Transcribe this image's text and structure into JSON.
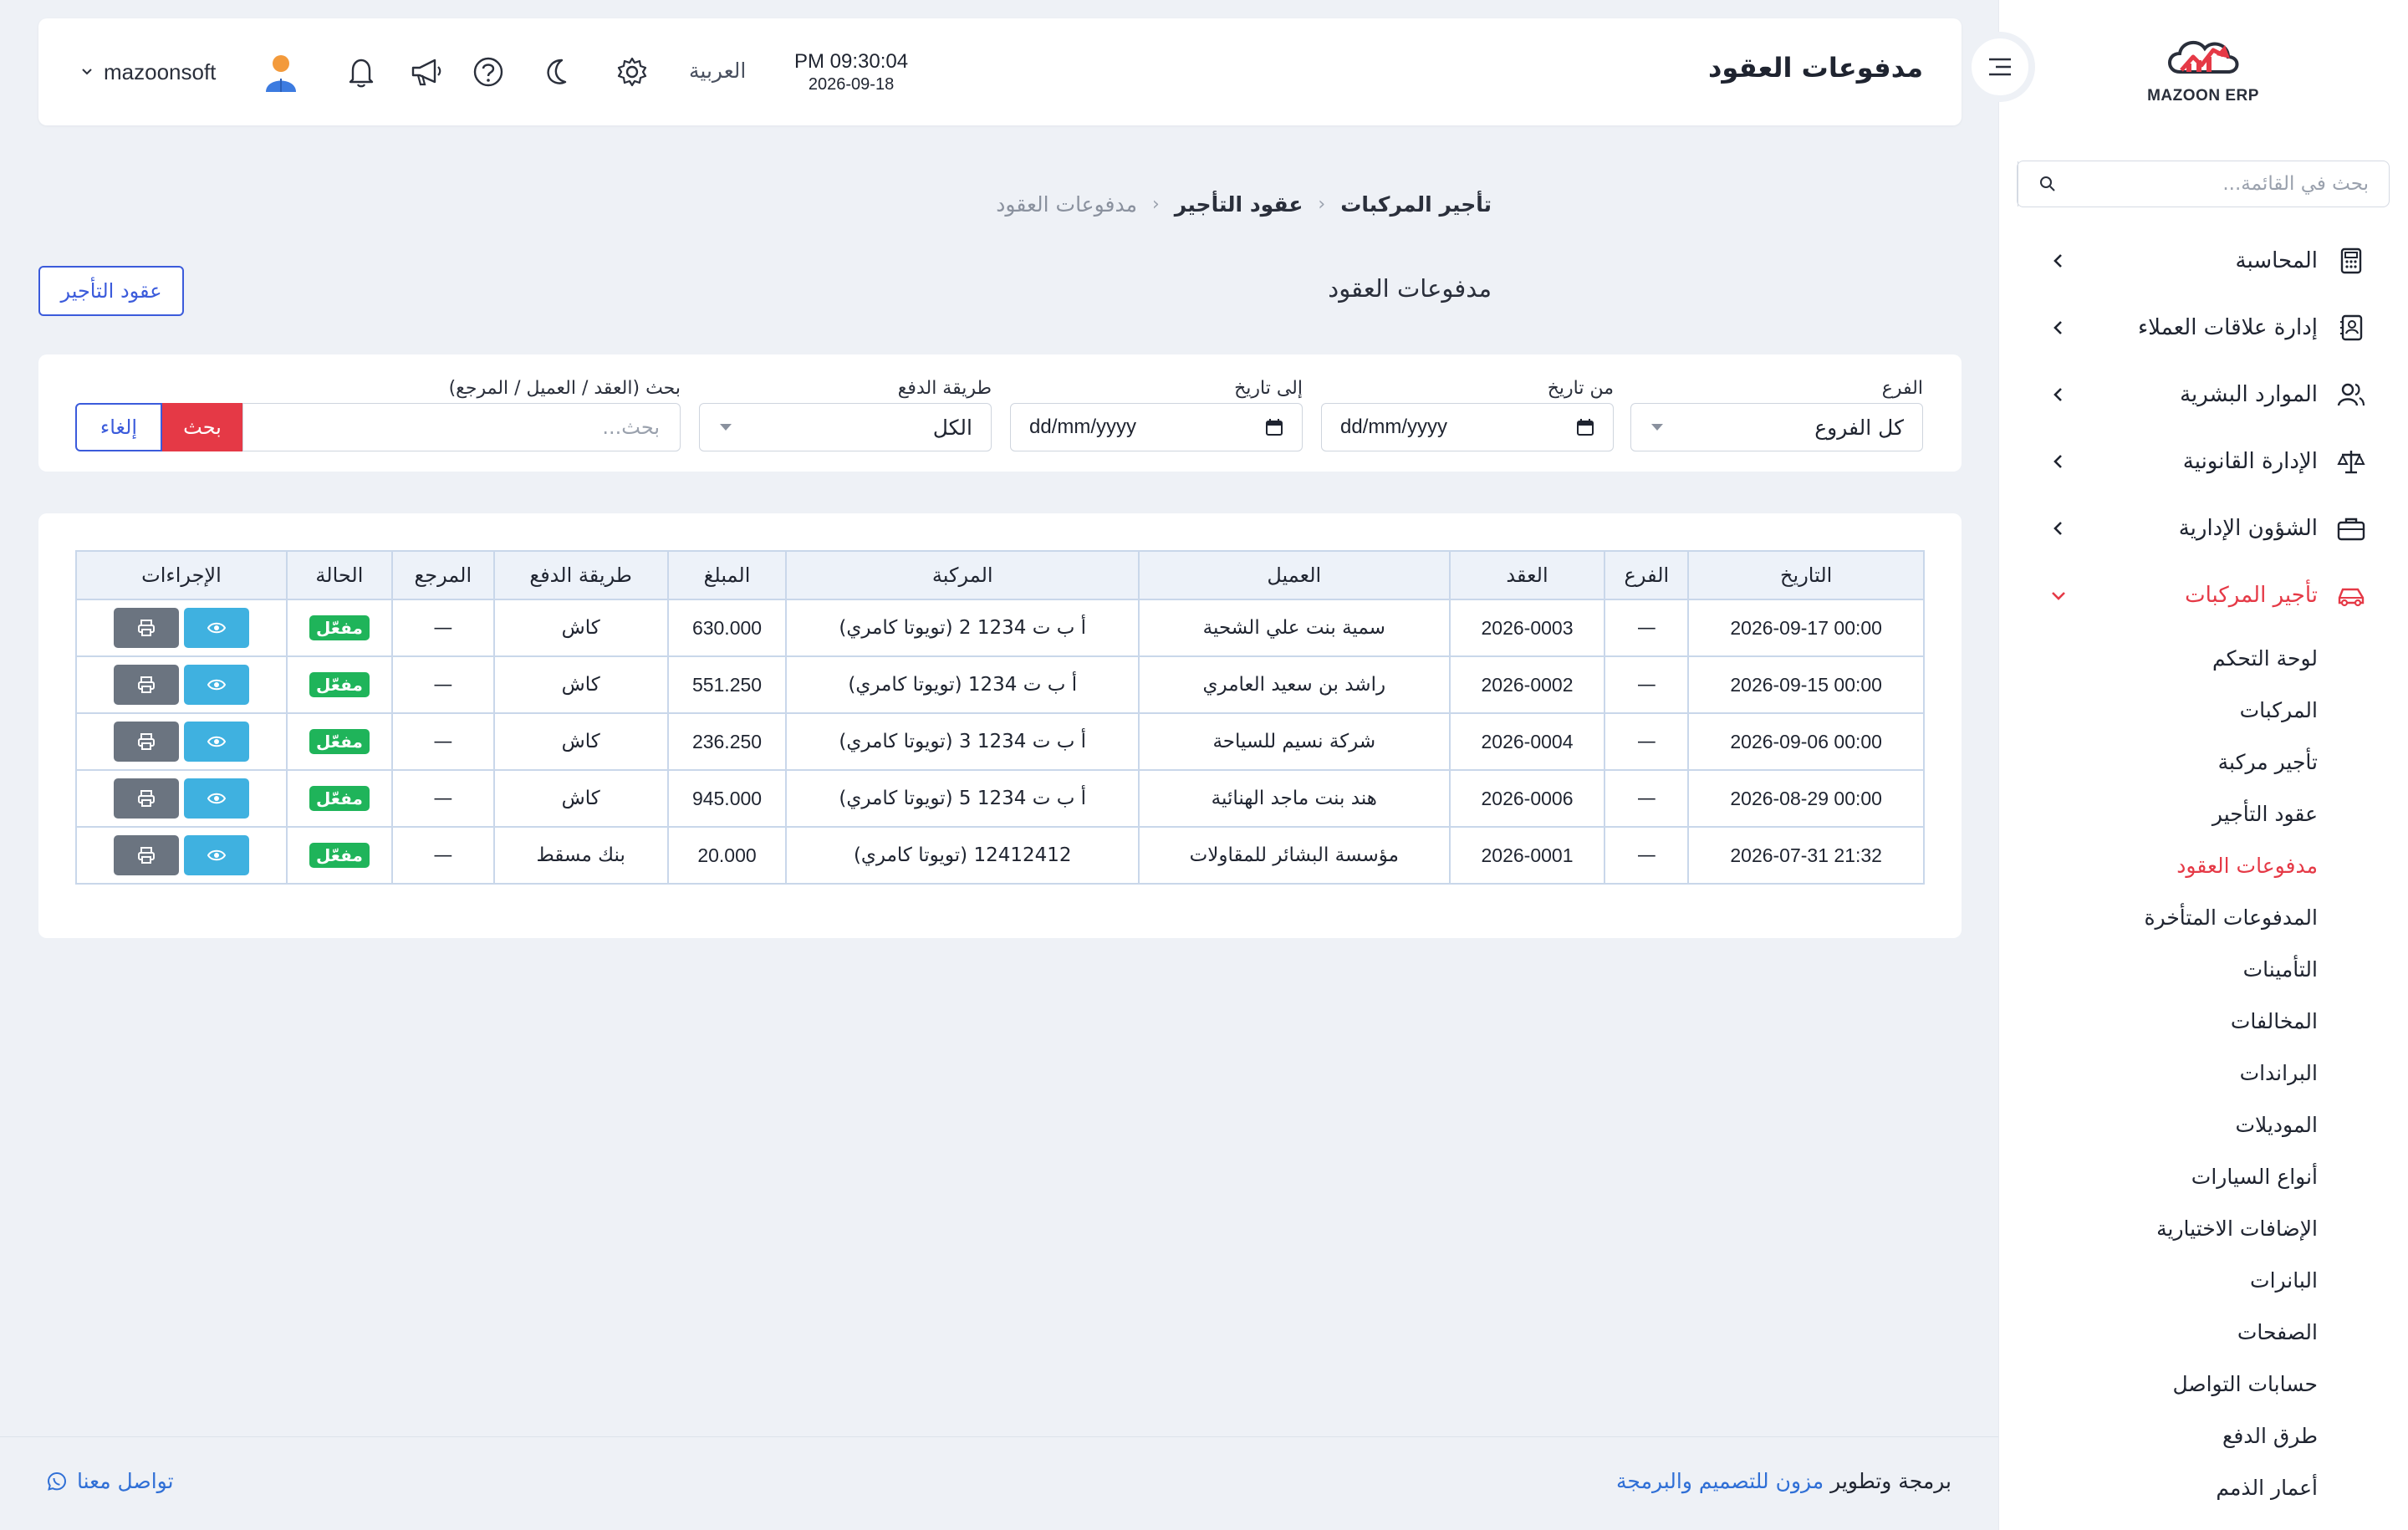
{
  "header": {
    "title": "مدفوعات العقود",
    "clock_time": "PM 09:30:04",
    "clock_date": "2026-09-18",
    "language": "العربية",
    "username": "mazoonsoft"
  },
  "sidebar": {
    "logo_text": "MAZOON ERP",
    "search_placeholder": "بحث في القائمة...",
    "items": [
      {
        "label": "المحاسبة",
        "icon": "calculator-icon"
      },
      {
        "label": "إدارة علاقات العملاء",
        "icon": "address-book-icon"
      },
      {
        "label": "الموارد البشرية",
        "icon": "users-icon"
      },
      {
        "label": "الإدارة القانونية",
        "icon": "scale-icon"
      },
      {
        "label": "الشؤون الإدارية",
        "icon": "briefcase-icon"
      },
      {
        "label": "تأجير المركبات",
        "icon": "car-icon"
      }
    ],
    "sub_items": [
      "لوحة التحكم",
      "المركبات",
      "تأجير مركبة",
      "عقود التأجير",
      "مدفوعات العقود",
      "المدفوعات المتأخرة",
      "التأمينات",
      "المخالفات",
      "البراندات",
      "الموديلات",
      "أنواع السيارات",
      "الإضافات الاختيارية",
      "البانرات",
      "الصفحات",
      "حسابات التواصل",
      "طرق الدفع",
      "أعمار الذمم"
    ],
    "accent_color": "#e53946"
  },
  "breadcrumb": [
    "تأجير المركبات",
    "عقود التأجير",
    "مدفوعات العقود"
  ],
  "section": {
    "title": "مدفوعات العقود",
    "contracts_button": "عقود التأجير"
  },
  "filters": {
    "branch_label": "الفرع",
    "branch_value": "كل الفروع",
    "from_label": "من تاريخ",
    "from_value": "dd/mm/yyyy",
    "to_label": "إلى تاريخ",
    "to_value": "dd/mm/yyyy",
    "method_label": "طريقة الدفع",
    "method_value": "الكل",
    "search_label": "بحث (العقد / العميل / المرجع)",
    "search_placeholder": "بحث...",
    "search_button": "بحث",
    "cancel_button": "إلغاء"
  },
  "table": {
    "columns": [
      "التاريخ",
      "الفرع",
      "العقد",
      "العميل",
      "المركبة",
      "المبلغ",
      "طريقة الدفع",
      "المرجع",
      "الحالة",
      "الإجراءات"
    ],
    "rows": [
      {
        "date": "2026-09-17 00:00",
        "branch": "—",
        "contract": "2026-0003",
        "customer": "سمية بنت علي الشحية",
        "vehicle": "أ ب ت 1234 2 (تويوتا كامري)",
        "amount": "630.000",
        "method": "كاش",
        "ref": "—",
        "status": "مفعّل"
      },
      {
        "date": "2026-09-15 00:00",
        "branch": "—",
        "contract": "2026-0002",
        "customer": "راشد بن سعيد العامري",
        "vehicle": "أ ب ت 1234 (تويوتا كامري)",
        "amount": "551.250",
        "method": "كاش",
        "ref": "—",
        "status": "مفعّل"
      },
      {
        "date": "2026-09-06 00:00",
        "branch": "—",
        "contract": "2026-0004",
        "customer": "شركة نسيم للسياحة",
        "vehicle": "أ ب ت 1234 3 (تويوتا كامري)",
        "amount": "236.250",
        "method": "كاش",
        "ref": "—",
        "status": "مفعّل"
      },
      {
        "date": "2026-08-29 00:00",
        "branch": "—",
        "contract": "2026-0006",
        "customer": "هند بنت ماجد الهنائية",
        "vehicle": "أ ب ت 1234 5 (تويوتا كامري)",
        "amount": "945.000",
        "method": "كاش",
        "ref": "—",
        "status": "مفعّل"
      },
      {
        "date": "2026-07-31 21:32",
        "branch": "—",
        "contract": "2026-0001",
        "customer": "مؤسسة البشائر للمقاولات",
        "vehicle": "12412412 (تويوتا كامري)",
        "amount": "20.000",
        "method": "بنك مسقط",
        "ref": "—",
        "status": "مفعّل"
      }
    ]
  },
  "footer": {
    "credit_prefix": "برمجة وتطوير",
    "credit_link": "مزون للتصميم والبرمجة",
    "contact": "تواصل معنا"
  }
}
